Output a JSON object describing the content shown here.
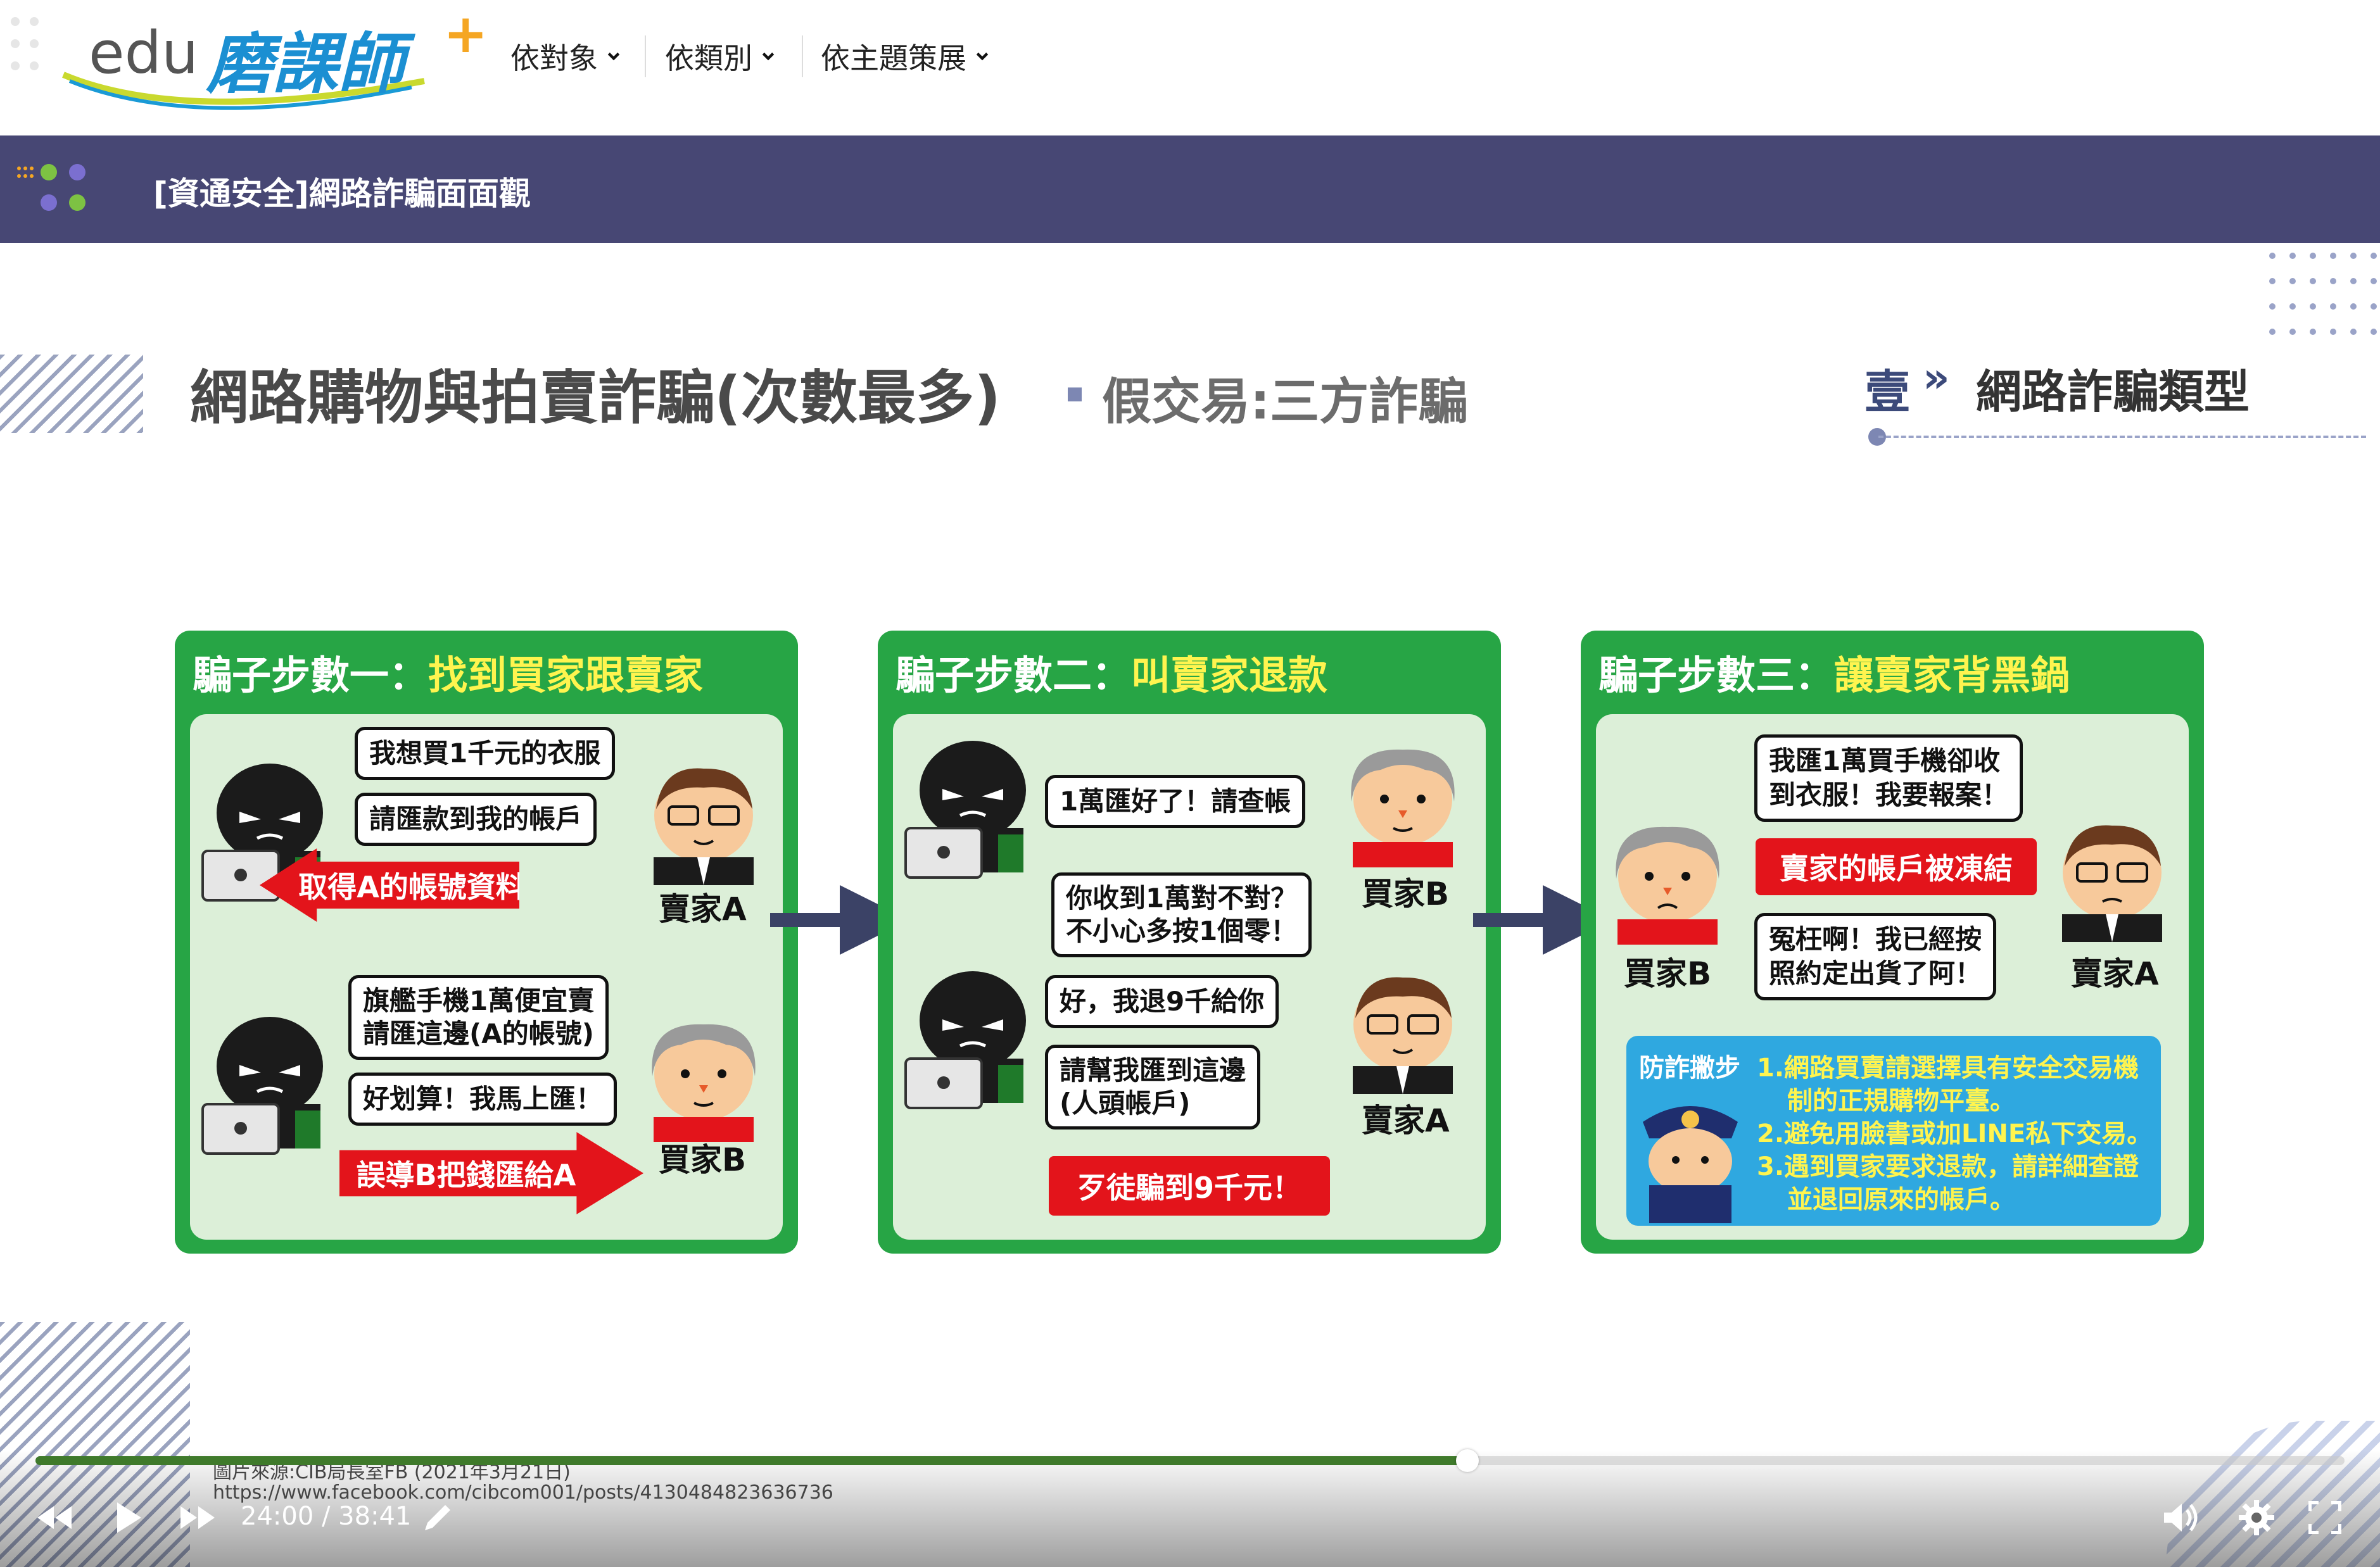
{
  "header": {
    "logo_prefix": "edu",
    "logo_name": "磨課師",
    "nav": [
      {
        "label": "依對象"
      },
      {
        "label": "依類別"
      },
      {
        "label": "依主題策展"
      }
    ]
  },
  "course": {
    "title": "[資通安全]網路詐騙面面觀"
  },
  "slide": {
    "title": "網路購物與拍賣詐騙(次數最多)",
    "subtitle": "假交易:三方詐騙",
    "section_num": "壹",
    "section_arrow": "»",
    "section_label": "網路詐騙類型",
    "panels": [
      {
        "head_prefix": "騙子步數一：",
        "head_highlight": "找到買家跟賣家",
        "b1": "我想買1千元的衣服",
        "b2": "請匯款到我的帳戶",
        "tag1": "取得A的帳號資料",
        "who1": "賣家A",
        "b3a": "旗艦手機1萬便宜賣",
        "b3b": "請匯這邊(A的帳號)",
        "b4": "好划算！我馬上匯！",
        "tag2": "誤導B把錢匯給A",
        "who2": "買家B"
      },
      {
        "head_prefix": "騙子步數二：",
        "head_highlight": "叫賣家退款",
        "b1": "1萬匯好了！請查帳",
        "who1": "買家B",
        "b2a": "你收到1萬對不對？",
        "b2b": "不小心多按1個零！",
        "b3": "好，我退9千給你",
        "b4a": "請幫我匯到這邊",
        "b4b": "(人頭帳戶)",
        "who2": "賣家A",
        "tag1": "歹徒騙到9千元！"
      },
      {
        "head_prefix": "騙子步數三：",
        "head_highlight": "讓賣家背黑鍋",
        "b1a": "我匯1萬買手機卻收",
        "b1b": "到衣服！我要報案！",
        "tag1": "賣家的帳戶被凍結",
        "b2a": "冤枉啊！我已經按",
        "b2b": "照約定出貨了阿！",
        "who1": "買家B",
        "who2": "賣家A",
        "tip_title": "防詐撇步",
        "tips": [
          "1.網路買賣請選擇具有安全交易機",
          "制的正規購物平臺。",
          "2.避免用臉書或加LINE私下交易。",
          "3.遇到買家要求退款，請詳細查證",
          "並退回原來的帳戶。"
        ]
      }
    ],
    "source_line1": "圖片來源:CIB局長室FB (2021年3月21日)",
    "source_line2": "https://www.facebook.com/cibcom001/posts/4130484823636736"
  },
  "player": {
    "current_time": "24:00",
    "duration": "38:41",
    "time_display": "24:00 / 38:41",
    "progress_fraction": 0.62,
    "accent": "#3f7a2b"
  },
  "colors": {
    "titlebar": "#474774",
    "panel_green": "#27a545",
    "alert_red": "#e3141b",
    "highlight_yellow": "#fff44f"
  }
}
